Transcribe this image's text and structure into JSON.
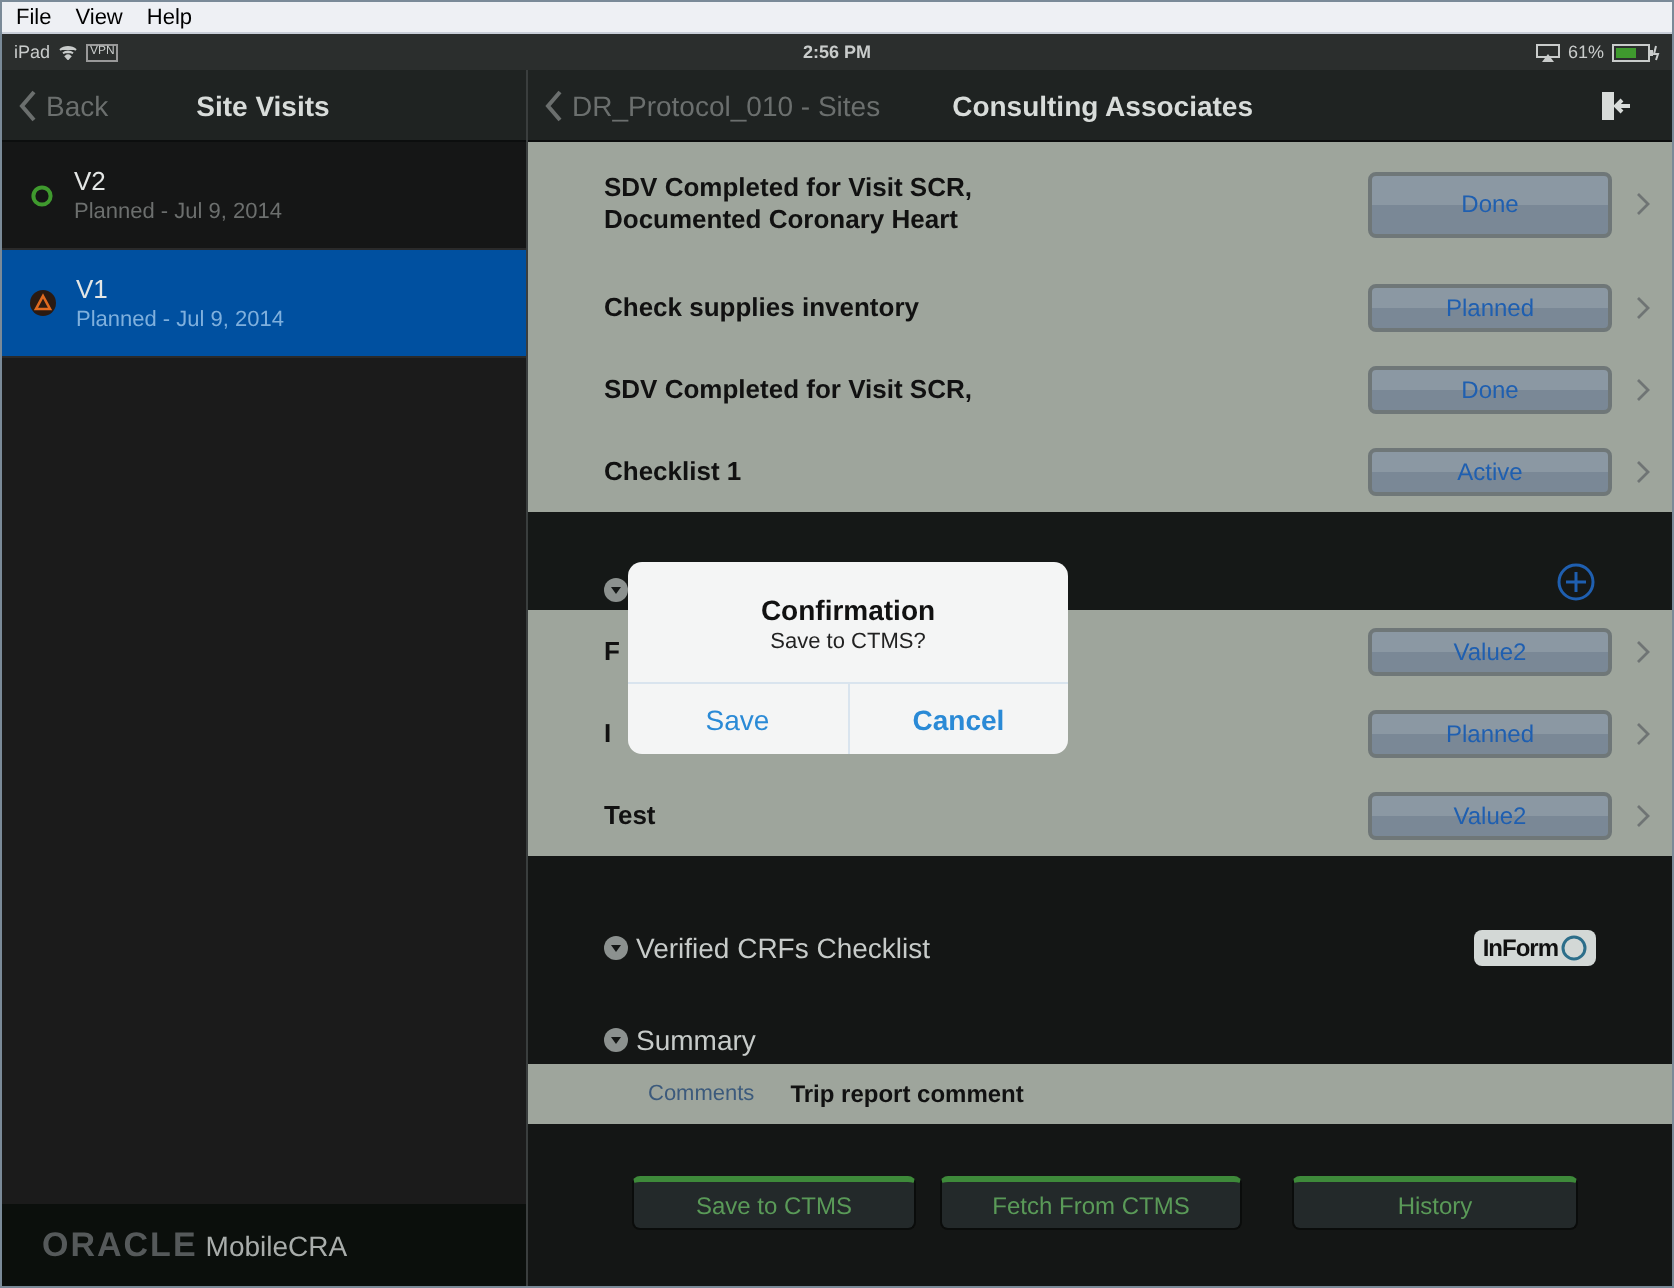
{
  "menu_bar": [
    "File",
    "View",
    "Help"
  ],
  "status_bar": {
    "device": "iPad",
    "vpn": "VPN",
    "time": "2:56 PM",
    "battery": "61%"
  },
  "sidebar": {
    "back": "Back",
    "title": "Site Visits",
    "items": [
      {
        "name": "V2",
        "subtitle": "Planned - Jul 9, 2014",
        "kind": "in_progress",
        "selected": false
      },
      {
        "name": "V1",
        "subtitle": "Planned - Jul 9, 2014",
        "kind": "warning",
        "selected": true
      }
    ],
    "brand": "ORACLE",
    "app_name": "MobileCRA"
  },
  "detail": {
    "back": "DR_Protocol_010 - Sites",
    "title": "Consulting Associates",
    "checklist_rows": [
      {
        "label": "SDV Completed for Visit SCR,\nDocumented Coronary Heart",
        "status": "Done"
      },
      {
        "label": "Check supplies inventory",
        "status": "Planned"
      },
      {
        "label": "SDV Completed for Visit SCR,",
        "status": "Done"
      },
      {
        "label": "Checklist 1",
        "status": "Active"
      }
    ],
    "second_rows": [
      {
        "label": "F",
        "status": "Value2"
      },
      {
        "label": "I",
        "status": "Planned"
      },
      {
        "label": "Test",
        "status": "Value2"
      }
    ],
    "sections": [
      {
        "title": "Verified CRFs Checklist",
        "logo": "InForm"
      },
      {
        "title": "Summary"
      }
    ],
    "comments_label": "Comments",
    "comment": "Trip report comment",
    "actions": [
      "Save to CTMS",
      "Fetch From CTMS",
      "History"
    ]
  },
  "dialog": {
    "title": "Confirmation",
    "message": "Save to CTMS?",
    "buttons": [
      "Save",
      "Cancel"
    ]
  }
}
